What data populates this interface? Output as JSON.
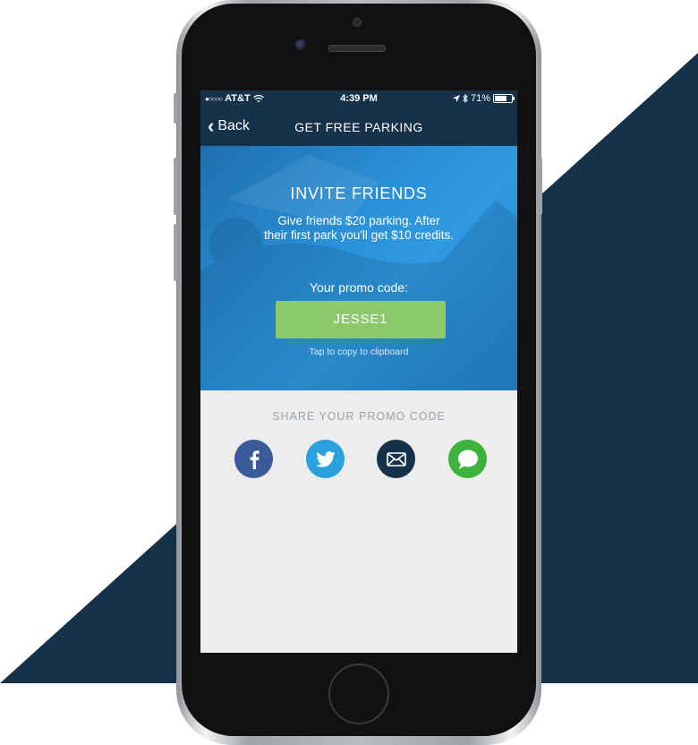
{
  "colors": {
    "navy": "#15324a",
    "hero_blue": "#2a8fd6",
    "promo_green": "#8bc96b",
    "screen_bg": "#ededed",
    "facebook": "#3b5a9a",
    "twitter": "#2ba0de",
    "email": "#15324a",
    "messages": "#3cb33a"
  },
  "status_bar": {
    "carrier": "AT&T",
    "time": "4:39 PM",
    "battery": "71%",
    "icons": [
      "signal-dots-icon",
      "wifi-icon",
      "location-arrow-icon",
      "bluetooth-icon",
      "battery-icon"
    ]
  },
  "nav": {
    "back_label": "Back",
    "title": "GET FREE PARKING"
  },
  "hero": {
    "title": "INVITE FRIENDS",
    "subtitle_line1": "Give friends $20 parking. After",
    "subtitle_line2": "their first park you'll get $10 credits.",
    "promo_label": "Your promo code:",
    "promo_code": "JESSE1",
    "copy_hint": "Tap to copy to clipboard"
  },
  "share": {
    "title": "SHARE YOUR PROMO CODE",
    "buttons": [
      {
        "icon": "facebook-icon"
      },
      {
        "icon": "twitter-icon"
      },
      {
        "icon": "email-icon"
      },
      {
        "icon": "messages-icon"
      }
    ]
  }
}
